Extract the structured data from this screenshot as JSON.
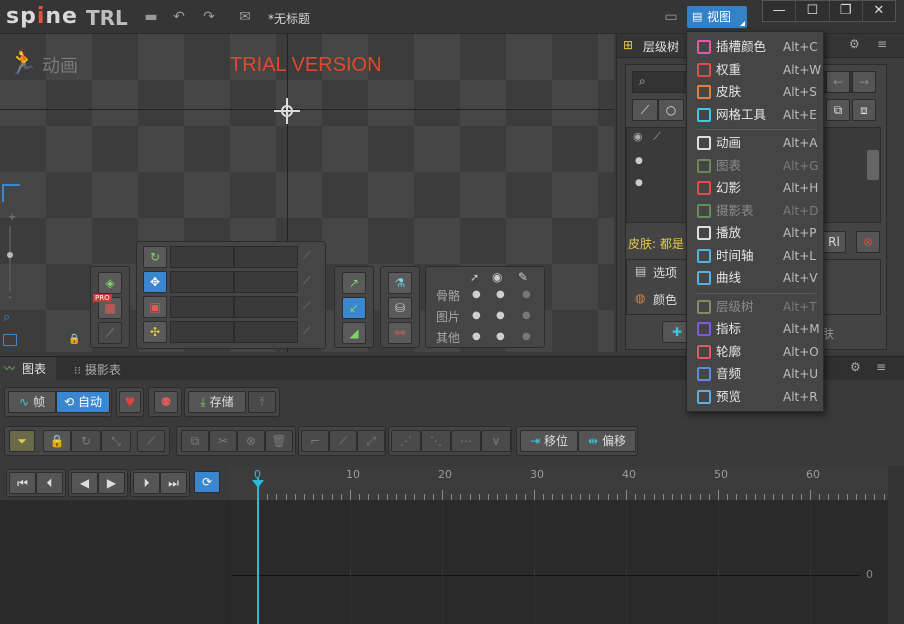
{
  "app": {
    "logo": "spine",
    "edition": "TRL",
    "doc_title": "*无标题",
    "view_button": "视图"
  },
  "window_buttons": [
    "—",
    "☐",
    "❐",
    "✕"
  ],
  "viewport": {
    "mode_label": "动画",
    "watermark": "TRIAL VERSION"
  },
  "tools": {
    "visibility": {
      "rows": [
        "骨骼",
        "图片",
        "其他"
      ]
    }
  },
  "tree_panel": {
    "title": "层级树",
    "skin_label": "皮肤: 都是",
    "options_label": "选项",
    "colors_label": "颜色",
    "skin_btn": "肤"
  },
  "view_menu": {
    "items": [
      {
        "label": "插槽颜色",
        "shortcut": "Alt+C",
        "icon": "color-wheel-icon",
        "color": "#e05aa8",
        "disabled": false
      },
      {
        "label": "权重",
        "shortcut": "Alt+W",
        "icon": "weights-icon",
        "color": "#e04a4a",
        "disabled": false
      },
      {
        "label": "皮肤",
        "shortcut": "Alt+S",
        "icon": "skin-icon",
        "color": "#e0803a",
        "disabled": false
      },
      {
        "label": "网格工具",
        "shortcut": "Alt+E",
        "icon": "mesh-icon",
        "color": "#3ac8e0",
        "disabled": false
      },
      {
        "label": "动画",
        "shortcut": "Alt+A",
        "icon": "animation-runner-icon",
        "color": "#dddddd",
        "disabled": false
      },
      {
        "label": "图表",
        "shortcut": "Alt+G",
        "icon": "graph-icon",
        "color": "#6a8a5a",
        "disabled": true
      },
      {
        "label": "幻影",
        "shortcut": "Alt+H",
        "icon": "ghost-icon",
        "color": "#e04a4a",
        "disabled": false
      },
      {
        "label": "摄影表",
        "shortcut": "Alt+D",
        "icon": "dopesheet-icon",
        "color": "#6a8a5a",
        "disabled": true
      },
      {
        "label": "播放",
        "shortcut": "Alt+P",
        "icon": "playback-icon",
        "color": "#dddddd",
        "disabled": false
      },
      {
        "label": "时间轴",
        "shortcut": "Alt+L",
        "icon": "timeline-icon",
        "color": "#5ab0e0",
        "disabled": false
      },
      {
        "label": "曲线",
        "shortcut": "Alt+V",
        "icon": "curve-icon",
        "color": "#5ab0e0",
        "disabled": false
      },
      {
        "label": "层级树",
        "shortcut": "Alt+T",
        "icon": "tree-icon",
        "color": "#8a8a6a",
        "disabled": true
      },
      {
        "label": "指标",
        "shortcut": "Alt+M",
        "icon": "metrics-icon",
        "color": "#7a5ae0",
        "disabled": false
      },
      {
        "label": "轮廓",
        "shortcut": "Alt+O",
        "icon": "outline-icon",
        "color": "#e05a5a",
        "disabled": false
      },
      {
        "label": "音频",
        "shortcut": "Alt+U",
        "icon": "audio-icon",
        "color": "#5a8ae0",
        "disabled": false
      },
      {
        "label": "预览",
        "shortcut": "Alt+R",
        "icon": "preview-eye-icon",
        "color": "#5ab0e0",
        "disabled": false
      }
    ]
  },
  "bottom": {
    "tabs": [
      "图表",
      "摄影表"
    ],
    "frame_btn": "帧",
    "auto_btn": "自动",
    "save_btn": "存储",
    "translate_btn": "移位",
    "offset_btn": "偏移",
    "ruler_labels": [
      "0",
      "10",
      "20",
      "30",
      "40",
      "50",
      "60"
    ],
    "graph_zero": "0"
  }
}
